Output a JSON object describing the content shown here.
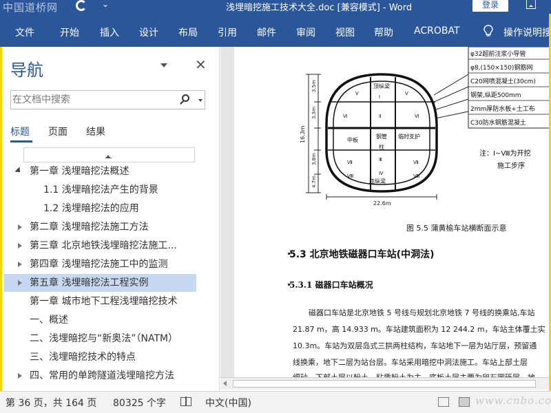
{
  "titlebar": {
    "watermark": "中国道桥网",
    "title": "浅埋暗挖施工技术大全.doc [兼容模式] - Word",
    "login": "登录"
  },
  "ribbon": {
    "tabs": [
      "文件",
      "开始",
      "插入",
      "设计",
      "布局",
      "引用",
      "邮件",
      "审阅",
      "视图",
      "帮助",
      "ACROBAT"
    ],
    "tell_me": "操作说明搜索"
  },
  "nav": {
    "title": "导航",
    "search_placeholder": "在文档中搜索",
    "tabs": {
      "headings": "标题",
      "pages": "页面",
      "results": "结果"
    },
    "items": [
      {
        "label": "第一章 浅埋暗挖法概述",
        "level": 1,
        "expand": "expanded"
      },
      {
        "label": "1.1 浅埋暗挖法产生的背景",
        "level": 2,
        "expand": "none"
      },
      {
        "label": "1.2 浅埋暗挖法的应用",
        "level": 2,
        "expand": "none"
      },
      {
        "label": "第二章 浅埋暗挖法施工方法",
        "level": 1,
        "expand": "collapsed"
      },
      {
        "label": "第三章 北京地铁浅埋暗挖法施工...",
        "level": 1,
        "expand": "collapsed"
      },
      {
        "label": "第四章 浅埋暗挖法施工中的监测",
        "level": 1,
        "expand": "collapsed"
      },
      {
        "label": "第五章 浅埋暗挖法工程实例",
        "level": 1,
        "expand": "collapsed",
        "selected": true
      },
      {
        "label": "第一章 城市地下工程浅埋暗挖技术",
        "level": 1,
        "expand": "none"
      },
      {
        "label": "一、概述",
        "level": 1,
        "expand": "none"
      },
      {
        "label": "二、浅埋暗挖与“新奥法”（NATM）",
        "level": 1,
        "expand": "none"
      },
      {
        "label": "三、浅埋暗挖技术的特点",
        "level": 1,
        "expand": "none"
      },
      {
        "label": "四、常用的单跨隧道浅埋暗挖方法",
        "level": 1,
        "expand": "collapsed"
      }
    ]
  },
  "document": {
    "figure": {
      "top_label": "顶纵梁",
      "mid_labels": [
        "中板",
        "钢管",
        "临时支护",
        "柱"
      ],
      "bottom_label": "底纵梁",
      "width_label": "22.6m",
      "dims_left": [
        "16.3m",
        "3.5m",
        "3.3m",
        "4.7m",
        "3.8m"
      ],
      "legend": [
        "φ32超前注浆小导管",
        "φ8,(150×150)钢筋网",
        "C20网喷混凝土(30cm)",
        "钢架,纵距500mm",
        "2mm厚防水板+土工布",
        "C30防水钢筋混凝土"
      ],
      "note_line1": "注：Ⅰ~Ⅷ为开挖",
      "note_line2": "施工步序",
      "roman": [
        "Ⅰ",
        "Ⅱ",
        "Ⅲ",
        "Ⅳ",
        "Ⅴ",
        "Ⅵ",
        "Ⅶ",
        "Ⅷ"
      ]
    },
    "caption": "图 5.5 蒲黄榆车站横断面示意",
    "h2": "5.3    北京地铁磁器口车站(中洞法)",
    "h3": "5.3.1  磁器口车站概况",
    "paragraph": [
      "磁器口车站是北京地铁 5 号线与规划北京地铁 7 号线的换乘站,车站",
      "21.87 m，高 14.933 m。车站建筑面积为 12 244.2 m，车站主体覆土实",
      "10.3m。车站为双层岛式三拱两柱结构，车站地下一层为站厅层，预留通",
      "线换乘，地下二层为站台层。车站采用暗挖中洞法施工。车站上部土层",
      "细砂，下部土层以粉土、粘质粉土为主，底板土层主要为卵石圆砾层，地"
    ]
  },
  "status": {
    "page": "第 36 页，共 164 页",
    "words": "80325 个字",
    "language": "中文(中国)",
    "watermark": "www.cnbo.com"
  },
  "colors": {
    "accent": "#2b579a",
    "selection": "#c7d9f1",
    "border_yellow": "#f2d500"
  }
}
